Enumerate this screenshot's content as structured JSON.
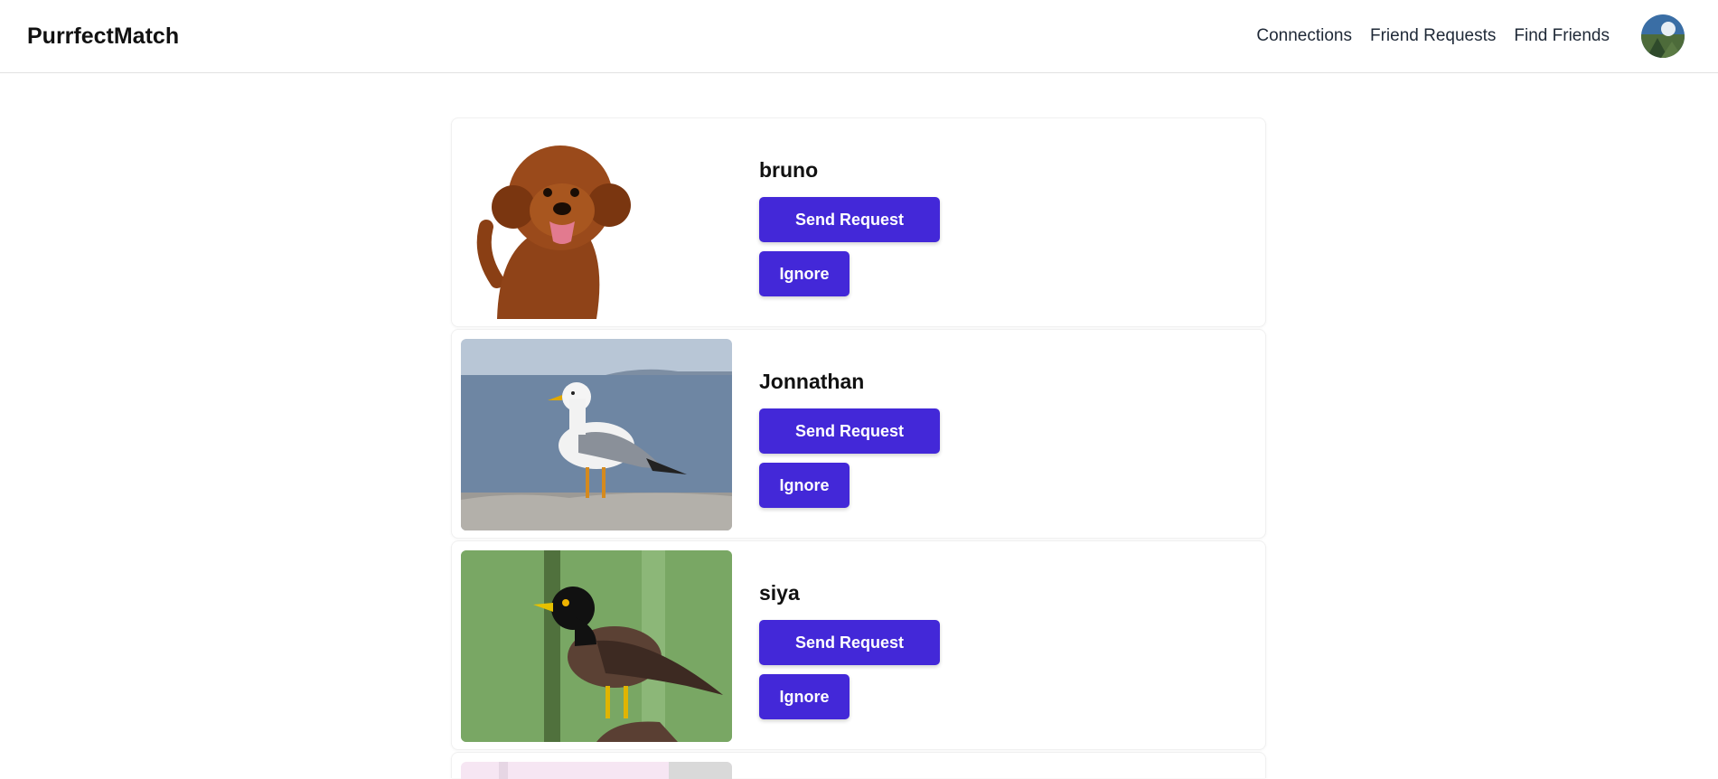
{
  "app": {
    "brand": "PurrfectMatch"
  },
  "nav": {
    "links": [
      {
        "label": "Connections"
      },
      {
        "label": "Friend Requests"
      },
      {
        "label": "Find Friends"
      }
    ]
  },
  "profiles": [
    {
      "name": "bruno",
      "photo": "dog-photo",
      "send_label": "Send Request",
      "ignore_label": "Ignore"
    },
    {
      "name": "Jonnathan",
      "photo": "seagull-photo",
      "send_label": "Send Request",
      "ignore_label": "Ignore"
    },
    {
      "name": "siya",
      "photo": "myna-bird-photo",
      "send_label": "Send Request",
      "ignore_label": "Ignore"
    }
  ],
  "colors": {
    "accent": "#4328d8",
    "text": "#111111",
    "border": "#e2e2e2"
  }
}
